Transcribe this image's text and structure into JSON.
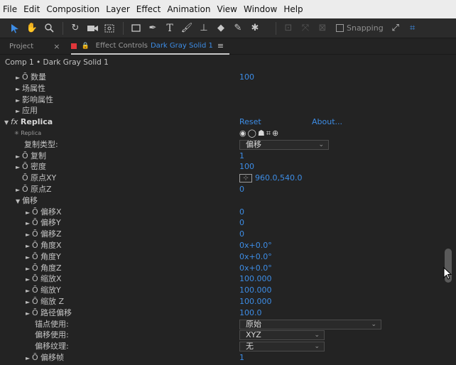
{
  "menu": [
    "File",
    "Edit",
    "Composition",
    "Layer",
    "Effect",
    "Animation",
    "View",
    "Window",
    "Help"
  ],
  "toolbar": {
    "snapping_label": "Snapping"
  },
  "tabs": {
    "project_label": "Project",
    "effect_controls_label": "Effect Controls",
    "layer_name": "Dark Gray Solid 1",
    "close_glyph": "×",
    "menu_glyph": "≡"
  },
  "comp_line": "Comp 1 • Dark Gray Solid 1",
  "rows": {
    "r0": {
      "name": "数量",
      "value": "100"
    },
    "r1": {
      "name": "场属性"
    },
    "r2": {
      "name": "影响属性"
    },
    "r3": {
      "name": "应用"
    },
    "replica": {
      "name": "Replica",
      "reset": "Reset",
      "about": "About...",
      "sub": "Replica"
    },
    "copy_type": {
      "name": "复制类型:",
      "value": "偏移"
    },
    "copy": {
      "name": "复制",
      "value": "1"
    },
    "density": {
      "name": "密度",
      "value": "100"
    },
    "origin_xy": {
      "name": "原点XY",
      "value": "960.0,540.0"
    },
    "origin_z": {
      "name": "原点Z",
      "value": "0"
    },
    "offset_group": {
      "name": "偏移"
    },
    "offset_x": {
      "name": "偏移X",
      "value": "0"
    },
    "offset_y": {
      "name": "偏移Y",
      "value": "0"
    },
    "offset_z": {
      "name": "偏移Z",
      "value": "0"
    },
    "angle_x": {
      "name": "角度X",
      "value": "0x+0.0°"
    },
    "angle_y": {
      "name": "角度Y",
      "value": "0x+0.0°"
    },
    "angle_z": {
      "name": "角度Z",
      "value": "0x+0.0°"
    },
    "scale_x": {
      "name": "缩放X",
      "value": "100.000"
    },
    "scale_y": {
      "name": "缩放Y",
      "value": "100.000"
    },
    "scale_z": {
      "name": "缩放 Z",
      "value": "100.000"
    },
    "path_offset": {
      "name": "路径偏移",
      "value": "100.0"
    },
    "anchor_use": {
      "name": "锚点使用:",
      "value": "原始"
    },
    "offset_use": {
      "name": "偏移使用:",
      "value": "XYZ"
    },
    "offset_texture": {
      "name": "偏移纹理:",
      "value": "无"
    },
    "offset_frame": {
      "name": "偏移帧",
      "value": "1"
    }
  },
  "colors": {
    "accent": "#3d8de6",
    "panel": "#232323",
    "text": "#c3c3c3"
  }
}
